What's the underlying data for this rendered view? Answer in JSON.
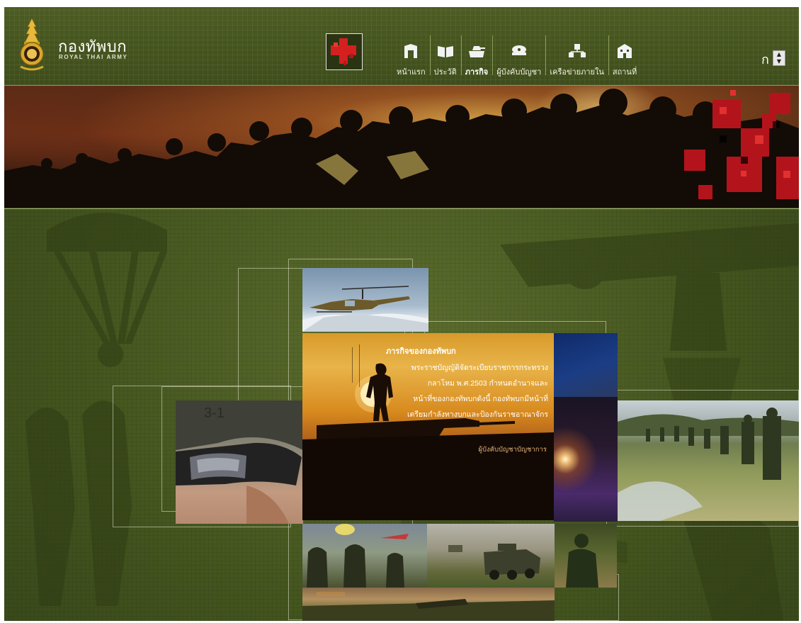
{
  "brand": {
    "name": "กองทัพบก",
    "subtitle": "ROYAL THAI ARMY"
  },
  "nav": {
    "items": [
      {
        "label": "หน้าแรก",
        "icon": "gate-icon"
      },
      {
        "label": "ประวัติ",
        "icon": "book-icon"
      },
      {
        "label": "ภารกิจ",
        "icon": "tank-icon",
        "active": true
      },
      {
        "label": "ผู้บังคับบัญชา",
        "icon": "officer-cap-icon"
      },
      {
        "label": "เครือข่ายภายใน",
        "icon": "network-icon"
      },
      {
        "label": "สถานที่",
        "icon": "building-icon"
      }
    ]
  },
  "font_size_control": {
    "glyph": "ก",
    "up": "▲",
    "down": "▼"
  },
  "mission": {
    "title": "ภารกิจของกองทัพบก",
    "body_lines": [
      "พระราชบัญญัติจัดระเบียบราชการกระทรวง",
      "กลาโหม พ.ศ.2503 กำหนดอำนาจและ",
      "หน้าที่ของกองทัพบกดังนี้ กองทัพบกมีหน้าที่",
      "เตรียมกำลังทางบกและป้องกันราชอาณาจักร"
    ],
    "signature": "ผู้บังคับบัญชาบัญชาการ"
  },
  "colors": {
    "header_bg": "#3e4d1b",
    "page_bg": "#45561f",
    "accent_red": "#d21f1f",
    "mission_gold": "#e8b44a"
  }
}
